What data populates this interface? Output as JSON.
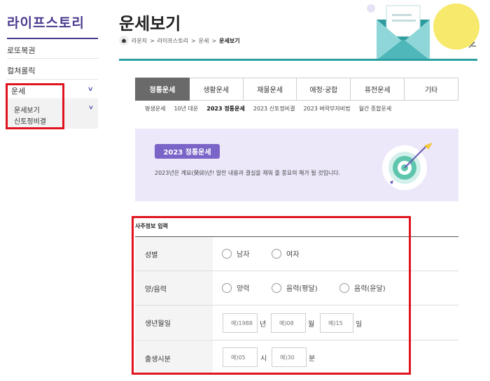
{
  "sidebar": {
    "brand": "라이프스토리",
    "items": [
      {
        "label": "로또복권"
      },
      {
        "label": "컬쳐롤릭"
      },
      {
        "label": "운세"
      }
    ],
    "sub_items": [
      {
        "label": "운세보기"
      },
      {
        "label": "신토정비결"
      }
    ]
  },
  "header": {
    "title": "운세보기",
    "breadcrumb": [
      "라운지",
      "라이프스토리",
      "운세",
      "운세보기"
    ]
  },
  "tabs": [
    {
      "label": "정통운세",
      "active": true
    },
    {
      "label": "생활운세",
      "active": false
    },
    {
      "label": "재물운세",
      "active": false
    },
    {
      "label": "애정·궁합",
      "active": false
    },
    {
      "label": "퓨전운세",
      "active": false
    },
    {
      "label": "기타",
      "active": false
    }
  ],
  "subtabs": [
    {
      "label": "평생운세"
    },
    {
      "label": "10년 대운"
    },
    {
      "label": "2023 정통운세",
      "active": true
    },
    {
      "label": "2023 신토정비결"
    },
    {
      "label": "2023 벼락부자비법"
    },
    {
      "label": "월간 종합운세"
    }
  ],
  "banner": {
    "tag": "2023 정통운세",
    "description": "2023년은 계묘(癸卯)년! 알찬 내용과 결실을 채워 줄 풍요의 해가 될 것입니다."
  },
  "form": {
    "title": "사주정보 입력",
    "gender_label": "성별",
    "gender_options": [
      "남자",
      "여자"
    ],
    "calendar_label": "양/음력",
    "calendar_options": [
      "양력",
      "음력(평달)",
      "음력(윤달)"
    ],
    "birth_label": "생년월일",
    "year_placeholder": "예)1988",
    "year_unit": "년",
    "month_placeholder": "예)08",
    "month_unit": "월",
    "day_placeholder": "예)15",
    "day_unit": "일",
    "time_label": "출생시분",
    "hour_placeholder": "예)05",
    "hour_unit": "시",
    "minute_placeholder": "예)30",
    "minute_unit": "분"
  },
  "colors": {
    "brand": "#4b3a8e",
    "accent_teal": "#2aa0a2",
    "active_tab": "#6a6a6a",
    "banner_bg": "#ece8fa",
    "tag_bg": "#7a64c8",
    "highlight": "#e0141e"
  }
}
